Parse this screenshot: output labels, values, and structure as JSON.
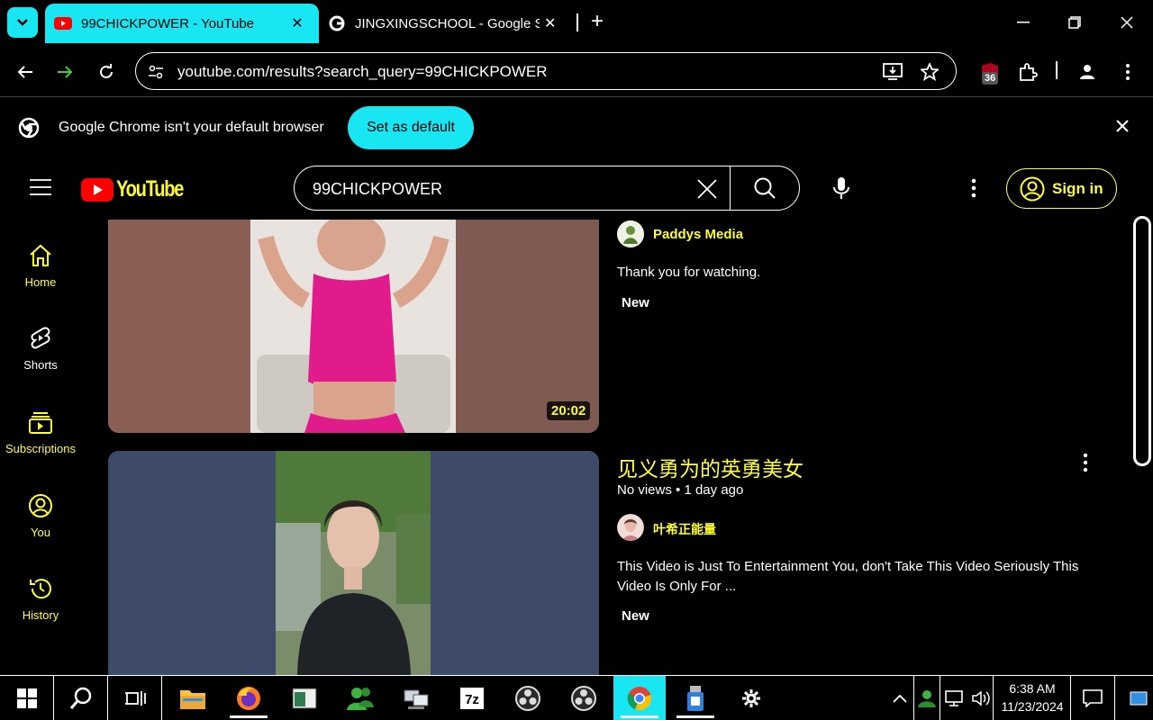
{
  "browser": {
    "tabs": [
      {
        "title": "99CHICKPOWER - YouTube",
        "active": true
      },
      {
        "title": "JINGXINGSCHOOL - Google Se",
        "active": false
      }
    ],
    "url": "youtube.com/results?search_query=99CHICKPOWER",
    "extension_badge": "36"
  },
  "infobar": {
    "message": "Google Chrome isn't your default browser",
    "button_label": "Set as default"
  },
  "youtube": {
    "logo_text": "YouTube",
    "search_value": "99CHICKPOWER",
    "signin_label": "Sign in",
    "sidebar": [
      {
        "label": "Home",
        "icon": "home-icon"
      },
      {
        "label": "Shorts",
        "icon": "shorts-icon"
      },
      {
        "label": "Subscriptions",
        "icon": "subscriptions-icon"
      },
      {
        "label": "You",
        "icon": "you-icon"
      },
      {
        "label": "History",
        "icon": "history-icon"
      }
    ],
    "results": [
      {
        "duration": "20:02",
        "channel": "Paddys Media",
        "description": "Thank you for watching.",
        "badge": "New"
      },
      {
        "title": "见义勇为的英勇美女",
        "views": "No views",
        "age": "1 day ago",
        "channel": "叶希正能量",
        "description": "This Video is Just To Entertainment You, don't Take This Video Seriously This Video Is Only For ...",
        "badge": "New"
      }
    ]
  },
  "taskbar": {
    "time": "6:38 AM",
    "date": "11/23/2024"
  },
  "colors": {
    "accent_cyan": "#18e6f2",
    "yt_yellow": "#ffff33",
    "yt_red": "#ff0000"
  }
}
